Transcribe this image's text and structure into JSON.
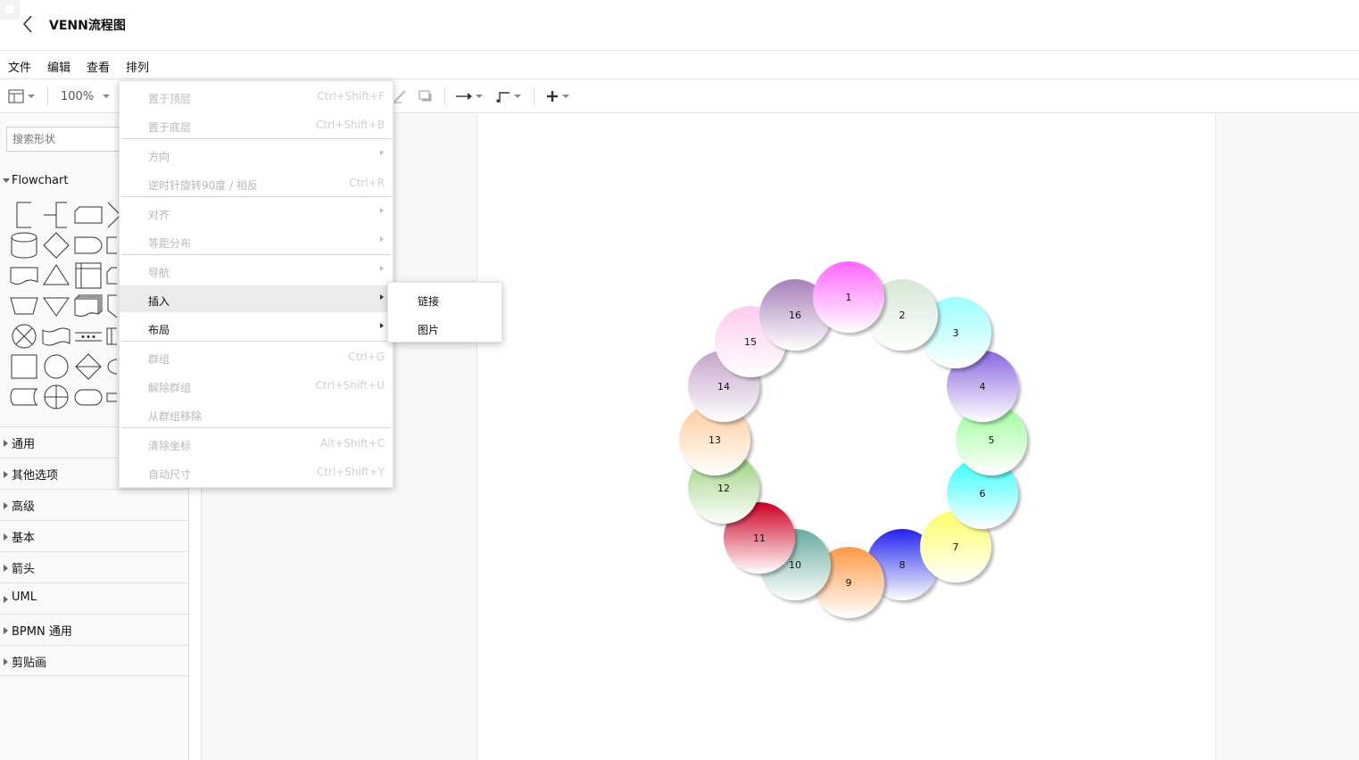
{
  "title": "VENN流程图",
  "menubar": [
    "文件",
    "编辑",
    "查看",
    "排列"
  ],
  "toolbar": {
    "zoom": "100%"
  },
  "sidebar": {
    "search_placeholder": "搜索形状",
    "flowchart_label": "Flowchart",
    "sections": [
      "通用",
      "其他选项",
      "高级",
      "基本",
      "箭头",
      "UML",
      "BPMN 通用",
      "剪贴画"
    ]
  },
  "arrange_menu": {
    "items": [
      {
        "label": "置于顶层",
        "shortcut": "Ctrl+Shift+F"
      },
      {
        "label": "置于底层",
        "shortcut": "Ctrl+Shift+B"
      },
      {
        "label": "方向",
        "shortcut": ""
      },
      {
        "label": "逆时针旋转90度 / 相反",
        "shortcut": "Ctrl+R"
      },
      {
        "label": "对齐",
        "shortcut": ""
      },
      {
        "label": "等距分布",
        "shortcut": ""
      },
      {
        "label": "导航",
        "shortcut": ""
      },
      {
        "label": "插入",
        "shortcut": ""
      },
      {
        "label": "布局",
        "shortcut": ""
      },
      {
        "label": "群组",
        "shortcut": "Ctrl+G"
      },
      {
        "label": "解除群组",
        "shortcut": "Ctrl+Shift+U"
      },
      {
        "label": "从群组移除",
        "shortcut": ""
      },
      {
        "label": "清除坐标",
        "shortcut": "Alt+Shift+C"
      },
      {
        "label": "自动尺寸",
        "shortcut": "Ctrl+Shift+Y"
      }
    ],
    "submenu": [
      "链接",
      "图片"
    ]
  },
  "diagram": {
    "circles": [
      {
        "label": "1",
        "color": "#ff66ff"
      },
      {
        "label": "2",
        "color": "#d5e8d4"
      },
      {
        "label": "3",
        "color": "#99ffff"
      },
      {
        "label": "4",
        "color": "#8866dd"
      },
      {
        "label": "5",
        "color": "#99ff99"
      },
      {
        "label": "6",
        "color": "#33ffff"
      },
      {
        "label": "7",
        "color": "#ffff66"
      },
      {
        "label": "8",
        "color": "#2222ee"
      },
      {
        "label": "9",
        "color": "#ff9944"
      },
      {
        "label": "10",
        "color": "#67ab9f"
      },
      {
        "label": "11",
        "color": "#cc0022"
      },
      {
        "label": "12",
        "color": "#97d077"
      },
      {
        "label": "13",
        "color": "#ffcc99"
      },
      {
        "label": "14",
        "color": "#c3a3c8"
      },
      {
        "label": "15",
        "color": "#ffccee"
      },
      {
        "label": "16",
        "color": "#a680b8"
      }
    ]
  }
}
